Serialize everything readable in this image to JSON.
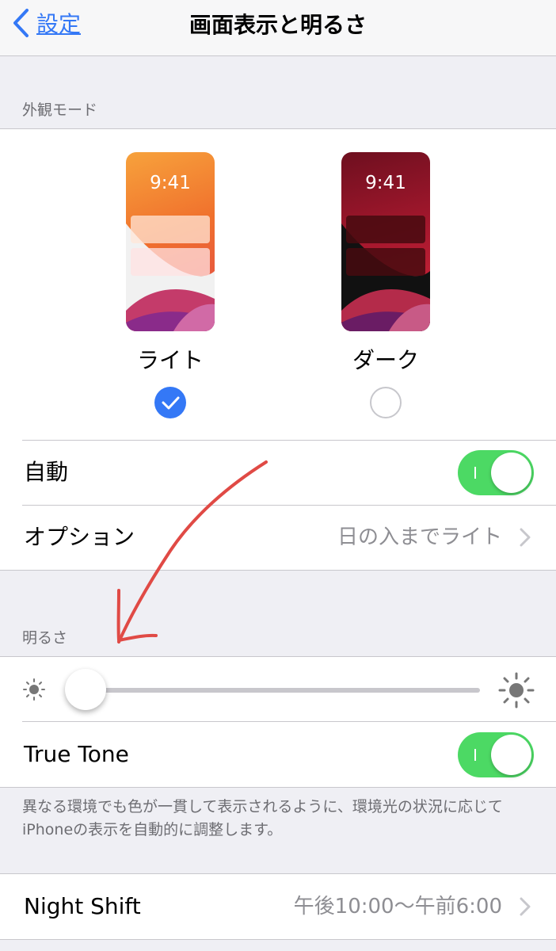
{
  "nav": {
    "back_label": "設定",
    "title": "画面表示と明るさ"
  },
  "appearance": {
    "header": "外観モード",
    "light": {
      "time": "9:41",
      "label": "ライト",
      "selected": true
    },
    "dark": {
      "time": "9:41",
      "label": "ダーク",
      "selected": false
    }
  },
  "auto_row": {
    "label": "自動",
    "on": true
  },
  "options_row": {
    "label": "オプション",
    "value": "日の入までライト"
  },
  "brightness": {
    "header": "明るさ",
    "level": 0.0
  },
  "true_tone": {
    "label": "True Tone",
    "on": true,
    "footer": "異なる環境でも色が一貫して表示されるように、環境光の状況に応じてiPhoneの表示を自動的に調整します。"
  },
  "night_shift": {
    "label": "Night Shift",
    "value": "午後10:00〜午前6:00"
  },
  "colors": {
    "accent": "#3478f6",
    "toggle_on": "#4cd964",
    "annotation_arrow": "#e04a45"
  }
}
